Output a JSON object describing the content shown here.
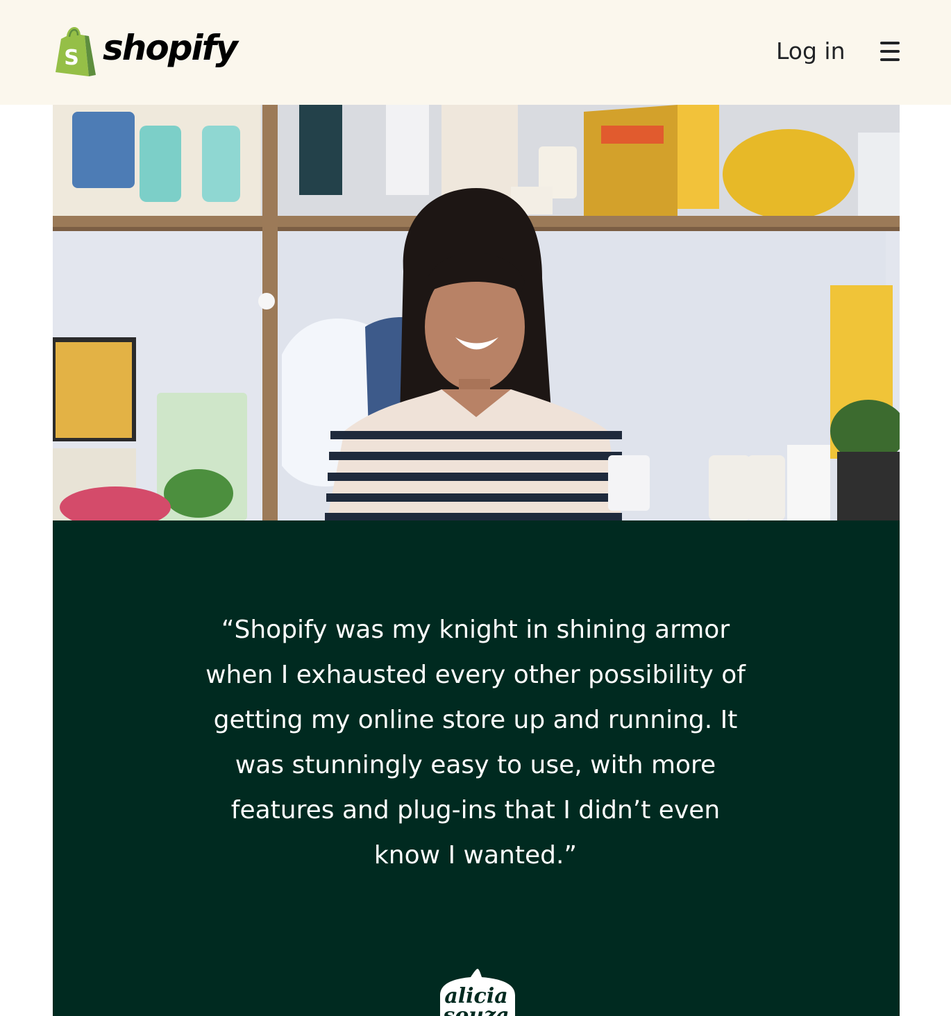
{
  "header": {
    "logo_text": "shopify",
    "login_label": "Log in",
    "menu_icon": "hamburger-menu-icon"
  },
  "hero": {
    "photo_subject": "store-owner-portrait"
  },
  "testimonial": {
    "quote": "“Shopify was my knight in shining armor when I exhausted every other possibility of getting my online store up and running. It was stunningly easy to use, with more features and plug-ins that I didn’t even know I wanted.”",
    "brand_logo_text": "alicia souza"
  },
  "colors": {
    "header_bg": "#fbf7ed",
    "panel_bg": "#002a20",
    "shopify_green": "#95bf47",
    "shopify_dark_green": "#5e8e3e",
    "text_dark": "#212326"
  }
}
